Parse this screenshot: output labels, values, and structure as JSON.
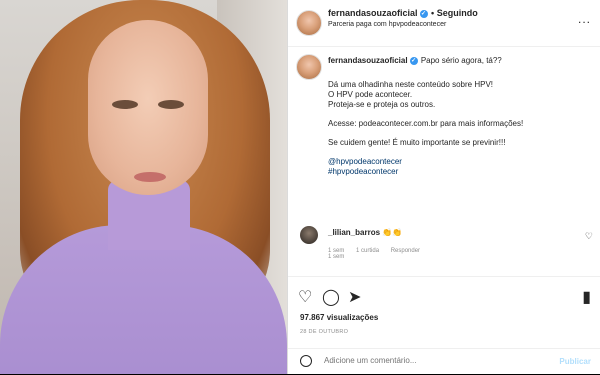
{
  "header": {
    "username": "fernandasouzaoficial",
    "separator": "•",
    "follow_label": "Seguindo",
    "subtitle": "Parceria paga com hpvpodeacontecer",
    "more": "..."
  },
  "caption": {
    "username": "fernandasouzaoficial",
    "first_line": "Papo sério agora, tá??",
    "paragraphs": [
      [
        "Dá uma olhadinha neste conteúdo sobre HPV!",
        "O HPV pode acontecer.",
        "Proteja-se e proteja os outros."
      ],
      [
        "Acesse: podeacontecer.com.br para mais informações!"
      ],
      [
        "Se cuidem gente! É muito importante se previnir!!!"
      ],
      [
        "@hpvpodeacontecer",
        "#hpvpodeacontecer"
      ]
    ],
    "time": "1 sem"
  },
  "comment": {
    "username": "_lilian_barros",
    "text": "👏👏",
    "meta_time": "1 sem",
    "meta_likes": "1 curtida",
    "meta_reply": "Responder"
  },
  "actions": {
    "like": "♡",
    "comment": "◯",
    "share": "➤",
    "save": "▮"
  },
  "likes_text": "97.867 visualizações",
  "date": "28 DE OUTUBRO",
  "add_comment": {
    "placeholder": "Adicione um comentário...",
    "publish": "Publicar"
  }
}
